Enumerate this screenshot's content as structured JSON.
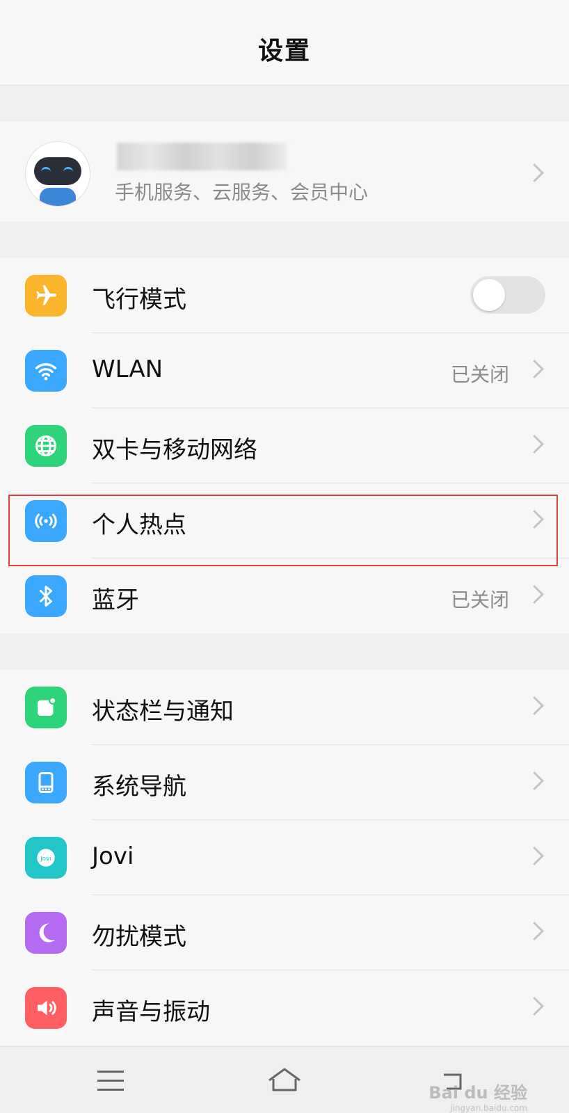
{
  "header": {
    "title": "设置"
  },
  "profile": {
    "subtitle": "手机服务、云服务、会员中心"
  },
  "network_items": [
    {
      "label": "飞行模式",
      "value": "",
      "icon": "airplane-icon",
      "color": "#fbb52c"
    },
    {
      "label": "WLAN",
      "value": "已关闭",
      "icon": "wifi-icon",
      "color": "#3aa8ff"
    },
    {
      "label": "双卡与移动网络",
      "value": "",
      "icon": "globe-icon",
      "color": "#2ed47a"
    },
    {
      "label": "个人热点",
      "value": "",
      "icon": "hotspot-icon",
      "color": "#3aa8ff"
    },
    {
      "label": "蓝牙",
      "value": "已关闭",
      "icon": "bluetooth-icon",
      "color": "#3aa8ff"
    }
  ],
  "system_items": [
    {
      "label": "状态栏与通知",
      "icon": "notification-icon",
      "color": "#2ed47a"
    },
    {
      "label": "系统导航",
      "icon": "navigation-icon",
      "color": "#3aa8ff"
    },
    {
      "label": "Jovi",
      "icon": "jovi-icon",
      "color": "#22c5c8"
    },
    {
      "label": "勿扰模式",
      "icon": "moon-icon",
      "color": "#b56af2"
    },
    {
      "label": "声音与振动",
      "icon": "sound-icon",
      "color": "#ff5e62"
    }
  ],
  "watermark": {
    "brand": "Bai du 经验",
    "url": "jingyan.baidu.com"
  }
}
